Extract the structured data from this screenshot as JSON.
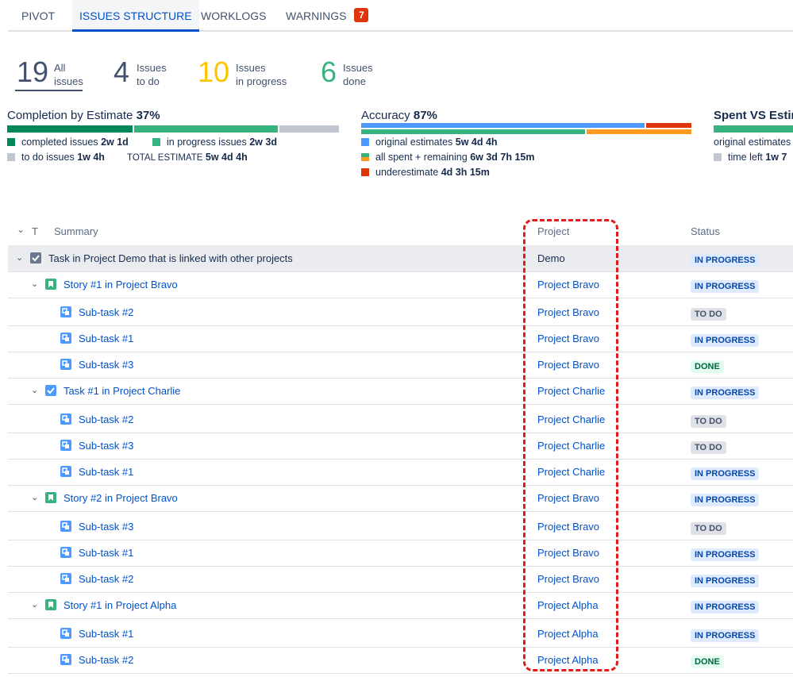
{
  "tabs": [
    {
      "label": "PIVOT"
    },
    {
      "label": "ISSUES STRUCTURE"
    },
    {
      "label": "WORKLOGS"
    },
    {
      "label": "WARNINGS",
      "badge": "7"
    }
  ],
  "stats": [
    {
      "num": "19",
      "line1": "All",
      "line2": "issues",
      "color": "#42526e"
    },
    {
      "num": "4",
      "line1": "Issues",
      "line2": "to do",
      "color": "#42526e"
    },
    {
      "num": "10",
      "line1": "Issues",
      "line2": "in progress",
      "color": "#ffc400"
    },
    {
      "num": "6",
      "line1": "Issues",
      "line2": "done",
      "color": "#36b37e"
    }
  ],
  "completion": {
    "title": "Completion by Estimate",
    "pct": "37%",
    "legend": [
      {
        "label": "completed issues",
        "value": "2w 1d",
        "color": "#00875a"
      },
      {
        "label": "in progress issues",
        "value": "2w 3d",
        "color": "#36b37e"
      },
      {
        "label": "to do issues",
        "value": "1w 4h",
        "color": "#c1c7d0"
      }
    ],
    "total_label": "TOTAL ESTIMATE",
    "total_value": "5w 4d 4h"
  },
  "accuracy": {
    "title": "Accuracy",
    "pct": "87%",
    "legend": [
      {
        "label": "original estimates",
        "value": "5w 4d 4h",
        "color": "#4c9aff"
      },
      {
        "label": "all spent + remaining",
        "value": "6w 3d 7h 15m",
        "color": "mixed"
      },
      {
        "label": "underestimate",
        "value": "4d 3h 15m",
        "color": "#de350b"
      }
    ]
  },
  "spent": {
    "title": "Spent VS Estim",
    "legend": [
      {
        "label": "original estimates",
        "color": "#36b37e"
      },
      {
        "label": "time left",
        "value": "1w 7",
        "color": "#c1c7d0"
      }
    ]
  },
  "columns": {
    "toggle": "⌄",
    "type": "T",
    "summary": "Summary",
    "project": "Project",
    "status": "Status"
  },
  "rows": [
    {
      "level": 0,
      "type": "task-done",
      "summary": "Task in Project Demo that is linked with other projects",
      "project": "Demo",
      "status": "IN PROGRESS",
      "highlight": true,
      "link": false
    },
    {
      "level": 1,
      "type": "story",
      "summary": "Story #1 in Project Bravo",
      "project": "Project Bravo",
      "status": "IN PROGRESS"
    },
    {
      "level": 2,
      "type": "subtask",
      "summary": "Sub-task #2",
      "project": "Project Bravo",
      "status": "TO DO"
    },
    {
      "level": 2,
      "type": "subtask",
      "summary": "Sub-task #1",
      "project": "Project Bravo",
      "status": "IN PROGRESS"
    },
    {
      "level": 2,
      "type": "subtask",
      "summary": "Sub-task #3",
      "project": "Project Bravo",
      "status": "DONE"
    },
    {
      "level": 1,
      "type": "task",
      "summary": "Task #1 in Project Charlie",
      "project": "Project Charlie",
      "status": "IN PROGRESS"
    },
    {
      "level": 2,
      "type": "subtask",
      "summary": "Sub-task #2",
      "project": "Project Charlie",
      "status": "TO DO"
    },
    {
      "level": 2,
      "type": "subtask",
      "summary": "Sub-task #3",
      "project": "Project Charlie",
      "status": "TO DO"
    },
    {
      "level": 2,
      "type": "subtask",
      "summary": "Sub-task #1",
      "project": "Project Charlie",
      "status": "IN PROGRESS"
    },
    {
      "level": 1,
      "type": "story",
      "summary": "Story #2 in Project Bravo",
      "project": "Project Bravo",
      "status": "IN PROGRESS"
    },
    {
      "level": 2,
      "type": "subtask",
      "summary": "Sub-task #3",
      "project": "Project Bravo",
      "status": "TO DO"
    },
    {
      "level": 2,
      "type": "subtask",
      "summary": "Sub-task #1",
      "project": "Project Bravo",
      "status": "IN PROGRESS"
    },
    {
      "level": 2,
      "type": "subtask",
      "summary": "Sub-task #2",
      "project": "Project Bravo",
      "status": "IN PROGRESS"
    },
    {
      "level": 1,
      "type": "story",
      "summary": "Story #1 in Project Alpha",
      "project": "Project Alpha",
      "status": "IN PROGRESS"
    },
    {
      "level": 2,
      "type": "subtask",
      "summary": "Sub-task #1",
      "project": "Project Alpha",
      "status": "IN PROGRESS"
    },
    {
      "level": 2,
      "type": "subtask",
      "summary": "Sub-task #2",
      "project": "Project Alpha",
      "status": "DONE"
    }
  ]
}
